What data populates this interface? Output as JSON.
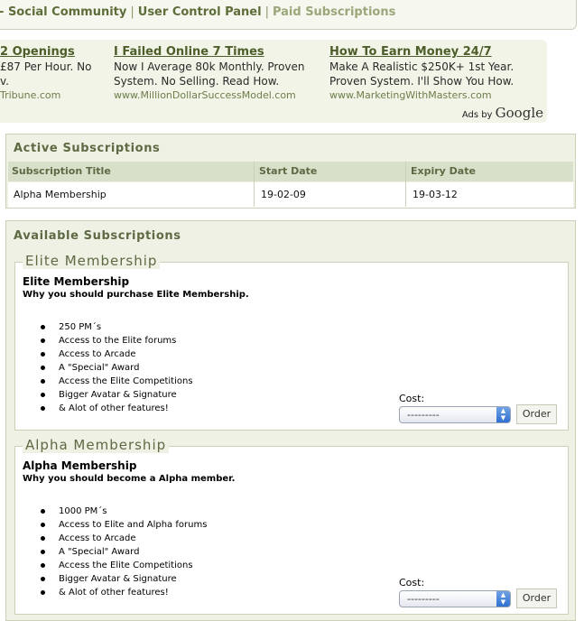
{
  "breadcrumb": {
    "prefix": "-",
    "items": [
      "Social Community",
      "User Control Panel",
      "Paid Subscriptions"
    ]
  },
  "ads": {
    "items": [
      {
        "title": "2 Openings",
        "line1": "£87 Per Hour. No",
        "line2": "v.",
        "url": "Tribune.com"
      },
      {
        "title": "I Failed Online 7 Times",
        "line1": "Now I Average 80k Monthly. Proven",
        "line2": "System. No Selling. Read How.",
        "url": "www.MillionDollarSuccessModel.com"
      },
      {
        "title": "How To Earn Money 24/7",
        "line1": "Make A Realistic $250K+ 1st Year.",
        "line2": "Proven System. I'll Show You How.",
        "url": "www.MarketingWithMasters.com"
      }
    ],
    "ads_by": "Ads by",
    "google": "Google"
  },
  "active": {
    "title": "Active Subscriptions",
    "columns": [
      "Subscription Title",
      "Start Date",
      "Expiry Date"
    ],
    "rows": [
      {
        "title": "Alpha Membership",
        "start": "19-02-09",
        "expiry": "19-03-12"
      }
    ]
  },
  "available": {
    "title": "Available Subscriptions",
    "plans": [
      {
        "legend": "Elite Membership",
        "name": "Elite Membership",
        "description": "Why you should purchase Elite Membership.",
        "features": [
          "250 PM´s",
          "Access to the Elite forums",
          "Access to Arcade",
          "A \"Special\" Award",
          "Access the Elite Competitions",
          "Bigger Avatar & Signature",
          "& Alot of other features!"
        ],
        "cost_label": "Cost:",
        "cost_value": "---------",
        "order_label": "Order"
      },
      {
        "legend": "Alpha Membership",
        "name": "Alpha Membership",
        "description": "Why you should become a Alpha member.",
        "features": [
          "1000 PM´s",
          "Access to Elite and Alpha forums",
          "Access to Arcade",
          "A \"Special\" Award",
          "Access the Elite Competitions",
          "Bigger Avatar & Signature",
          "& Alot of other features!"
        ],
        "cost_label": "Cost:",
        "cost_value": "---------",
        "order_label": "Order"
      }
    ]
  },
  "colors": {
    "brand_green": "#5e6e3a",
    "panel_bg": "#eef1e4",
    "header_bg": "#d9e0c9"
  }
}
